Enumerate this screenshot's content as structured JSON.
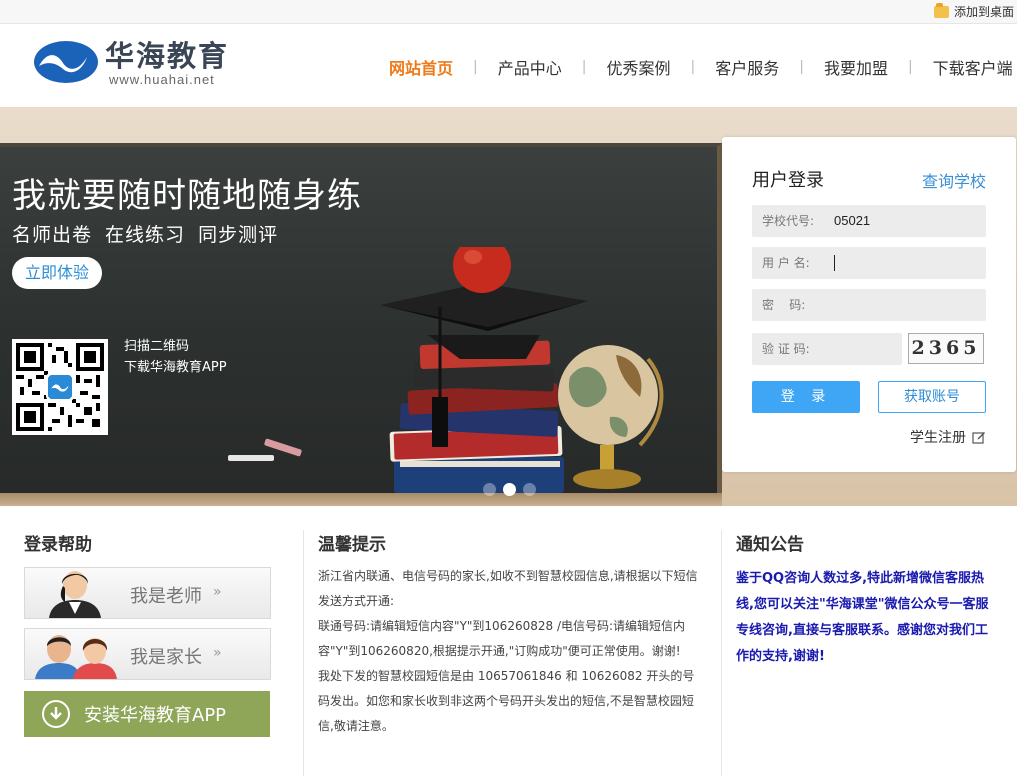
{
  "topbar": {
    "add_desktop": "添加到桌面"
  },
  "logo": {
    "name": "华海教育",
    "url": "www.huahai.net"
  },
  "nav": [
    {
      "label": "网站首页",
      "active": true
    },
    {
      "label": "产品中心",
      "active": false
    },
    {
      "label": "优秀案例",
      "active": false
    },
    {
      "label": "客户服务",
      "active": false
    },
    {
      "label": "我要加盟",
      "active": false
    },
    {
      "label": "下载客户端",
      "active": false
    }
  ],
  "banner": {
    "headline": "我就要随时随地随身练",
    "subline": "名师出卷 在线练习 同步测评",
    "try_button": "立即体验",
    "qr_line1": "扫描二维码",
    "qr_line2": "下载华海教育APP",
    "slides": [
      false,
      true,
      false
    ]
  },
  "login": {
    "title": "用户登录",
    "query_school": "查询学校",
    "school_code_label": "学校代号:",
    "school_code_value": "05021",
    "username_label": "用 户 名:",
    "password_label": "密    码:",
    "captcha_label": "验 证 码:",
    "captcha_value": "2365",
    "login_button": "登 录",
    "get_account_button": "获取账号",
    "student_register": "学生注册"
  },
  "help": {
    "title": "登录帮助",
    "teacher": "我是老师",
    "parent": "我是家长",
    "arrows": "»",
    "install_app": "安装华海教育APP"
  },
  "tips": {
    "title": "温馨提示",
    "paragraphs": [
      "浙江省内联通、电信号码的家长,如收不到智慧校园信息,请根据以下短信发送方式开通:",
      "联通号码:请编辑短信内容\"Y\"到106260828 /电信号码:请编辑短信内容\"Y\"到106260820,根据提示开通,\"订购成功\"便可正常使用。谢谢!",
      "我处下发的智慧校园短信是由 10657061846 和 10626082 开头的号码发出。如您和家长收到非这两个号码开头发出的短信,不是智慧校园短信,敬请注意。"
    ]
  },
  "announcement": {
    "title": "通知公告",
    "text": "鉴于QQ咨询人数过多,特此新增微信客服热线,您可以关注\"华海课堂\"微信公众号一客服专线咨询,直接与客服联系。感谢您对我们工作的支持,谢谢!"
  },
  "colors": {
    "accent": "#ef7a1a",
    "blue": "#3ea6f5",
    "green": "#8fa557",
    "notice_blue": "#1a1aaf"
  }
}
